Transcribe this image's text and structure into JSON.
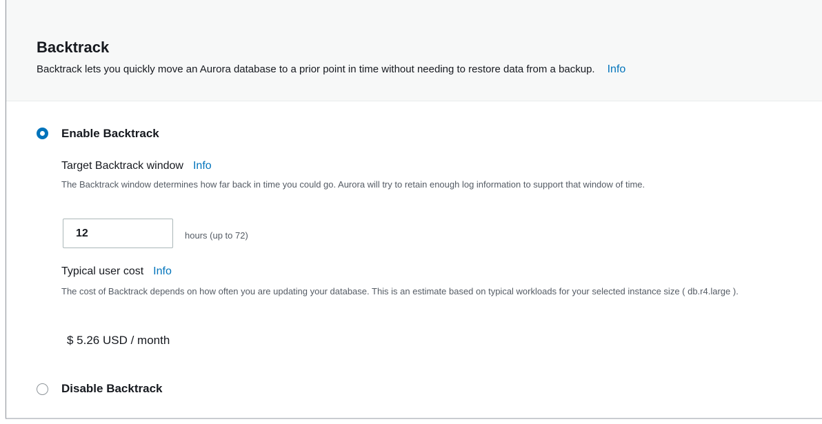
{
  "header": {
    "title": "Backtrack",
    "description": "Backtrack lets you quickly move an Aurora database to a prior point in time without needing to restore data from a backup.",
    "info_label": "Info"
  },
  "options": {
    "enable": {
      "label": "Enable Backtrack",
      "selected": true
    },
    "disable": {
      "label": "Disable Backtrack",
      "selected": false
    }
  },
  "window": {
    "label": "Target Backtrack window",
    "info_label": "Info",
    "description": "The Backtrack window determines how far back in time you could go. Aurora will try to retain enough log information to support that window of time.",
    "value": "12",
    "suffix": "hours (up to 72)"
  },
  "cost": {
    "label": "Typical user cost",
    "info_label": "Info",
    "description": "The cost of Backtrack depends on how often you are updating your database. This is an estimate based on typical workloads for your selected instance size ( db.r4.large ).",
    "value": "$ 5.26 USD / month"
  },
  "colors": {
    "accent": "#0073bb",
    "header_bg": "#f7f8f8",
    "muted_text": "#545b64"
  }
}
